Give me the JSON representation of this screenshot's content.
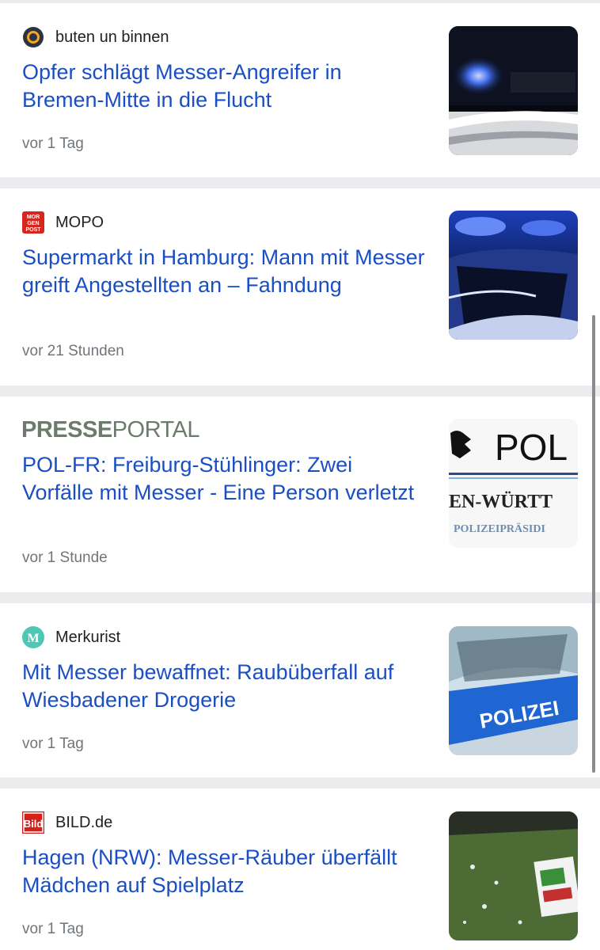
{
  "articles": [
    {
      "source": "buten un binnen",
      "source_icon": "buten-un-binnen-logo",
      "headline": "Opfer schlägt Messer-Angreifer in Bremen-Mitte in die Flucht",
      "age": "vor 1 Tag",
      "thumbnail": "police-car-blue-light-image"
    },
    {
      "source": "MOPO",
      "source_icon": "mopo-logo",
      "source_icon_text": "MOR GEN POST",
      "headline": "Supermarkt in Hamburg: Mann mit Messer greift Angestellten an – Fahndung",
      "age": "vor 21 Stunden",
      "thumbnail": "police-car-night-image"
    },
    {
      "source": "PRESSEPORTAL",
      "source_logo_parts": [
        "PRESSE",
        "PORTAL"
      ],
      "headline": "POL-FR: Freiburg-Stühlinger: Zwei Vorfälle mit Messer - Eine Person verletzt",
      "age": "vor 1 Stunde",
      "thumbnail": "police-logo-image",
      "thumbnail_text": {
        "line1": "POL",
        "line2": "EN-WÜRTT",
        "line3": "POLIZEIPRÄSIDI"
      }
    },
    {
      "source": "Merkurist",
      "source_icon": "merkurist-logo",
      "source_icon_text": "M",
      "headline": "Mit Messer bewaffnet: Raubüberfall auf Wiesbadener Drogerie",
      "age": "vor 1 Tag",
      "thumbnail": "polizei-car-image",
      "thumbnail_text": "POLIZEI"
    },
    {
      "source": "BILD.de",
      "source_icon": "bild-logo",
      "source_icon_text": "Bild",
      "headline": "Hagen (NRW): Messer-Räuber überfällt Mädchen auf Spielplatz",
      "age": "vor 1 Tag",
      "thumbnail": "playground-sign-image"
    }
  ],
  "colors": {
    "headline": "#1a4fc4",
    "age": "#70757a",
    "separator": "#ececee",
    "mopo_red": "#d7261e",
    "bild_red": "#d5201a",
    "merkurist_teal": "#4fc7b5"
  }
}
